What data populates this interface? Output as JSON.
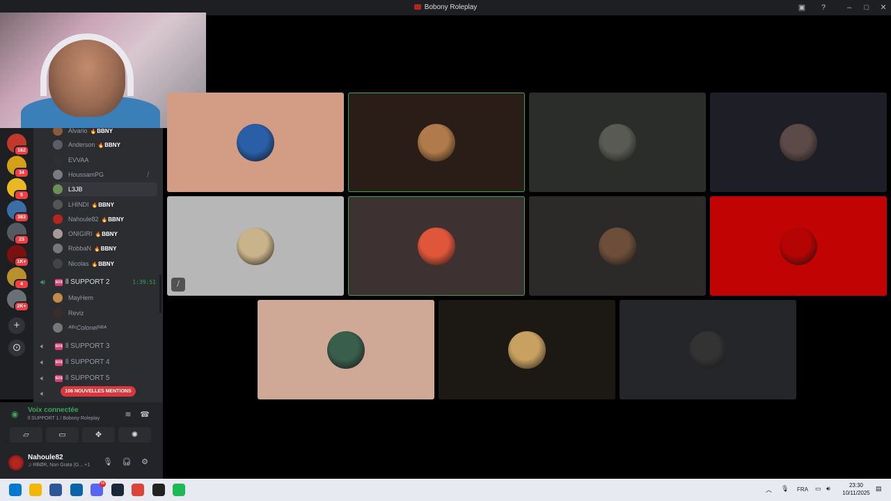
{
  "window": {
    "title": "Bobony Roleplay"
  },
  "icons": {
    "logo": "bobony-logo-icon",
    "inbox": "inbox-icon",
    "help": "help-icon",
    "minimize": "minimize-icon",
    "maximize": "maximize-icon",
    "close": "close-icon"
  },
  "servers": [
    {
      "name": "server-1",
      "badge": "162",
      "color": "#c0392b"
    },
    {
      "name": "server-2",
      "badge": "34",
      "color": "#d4a017"
    },
    {
      "name": "server-3",
      "badge": "5",
      "color": "#e8b923"
    },
    {
      "name": "server-4",
      "badge": "383",
      "color": "#3b6ea5"
    },
    {
      "name": "server-5",
      "badge": "23",
      "color": "#555a60"
    },
    {
      "name": "server-6",
      "badge": "1K+",
      "color": "#7a1111"
    },
    {
      "name": "server-7",
      "badge": "4",
      "color": "#b8912c"
    },
    {
      "name": "server-8",
      "badge": "2K+",
      "color": "#6b6f76"
    }
  ],
  "server_actions": {
    "add": "+",
    "discover": "⊙"
  },
  "members_top": [
    {
      "name": "Alvario",
      "tag": "BBNY",
      "color": "#8a5a3a"
    },
    {
      "name": "Anderson",
      "tag": "BBNY",
      "color": "#5a5f66"
    },
    {
      "name": "EVVAA",
      "tag": "",
      "color": "#2d2f33"
    },
    {
      "name": "HoussamPG",
      "tag": "",
      "color": "#777b82"
    },
    {
      "name": "L3JB",
      "tag": "",
      "color": "#6a8f58"
    },
    {
      "name": "LHINDI",
      "tag": "BBNY",
      "color": "#555"
    },
    {
      "name": "Nahoule82",
      "tag": "BBNY",
      "color": "#b3261e"
    },
    {
      "name": "ONIGIRI",
      "tag": "BBNY",
      "color": "#a99"
    },
    {
      "name": "RobbaN",
      "tag": "BBNY",
      "color": "#777"
    },
    {
      "name": "Nicolas",
      "tag": "BBNY",
      "color": "#444"
    }
  ],
  "support2": {
    "label": "SUPPORT 2",
    "timer": "1:39:51",
    "sos": "SOS",
    "prefix": "ll"
  },
  "members_support2": [
    {
      "name": "MayHem",
      "color": "#c48a4a"
    },
    {
      "name": "Reviz",
      "color": "#3a2d2a"
    },
    {
      "name": "ᴬᴮᶜColonelᴺᴮᴬ",
      "color": "#777"
    }
  ],
  "channels_other": [
    {
      "label": "SUPPORT 3"
    },
    {
      "label": "SUPPORT 4"
    },
    {
      "label": "SUPPORT 5"
    }
  ],
  "mentions_pill": "106 NOUVELLES MENTIONS",
  "voice": {
    "status": "Voix connectée",
    "channel": "ll SUPPORT 1 / Bobony Roleplay",
    "buttons": [
      "camera-off-icon",
      "screen-share-icon",
      "activities-icon",
      "soundboard-icon"
    ]
  },
  "user": {
    "name": "Nahoule82",
    "status": "♫ RBØR, Non Grata (G... +1"
  },
  "tiles": [
    {
      "bg": "#d39c84",
      "avatar": "#2a5fa8",
      "speaking": false,
      "muted": false
    },
    {
      "bg": "#2a1d18",
      "avatar": "#b07a4a",
      "speaking": true,
      "muted": false
    },
    {
      "bg": "#2a2d29",
      "avatar": "#5a5a55",
      "speaking": false,
      "muted": false
    },
    {
      "bg": "#1e1f26",
      "avatar": "#5c4a48",
      "speaking": false,
      "muted": false
    },
    {
      "bg": "#b7b7b7",
      "avatar": "#c9b38a",
      "speaking": false,
      "muted": true
    },
    {
      "bg": "#3d3131",
      "avatar": "#e0563a",
      "speaking": true,
      "muted": false
    },
    {
      "bg": "#2b2a28",
      "avatar": "#6d4e3a",
      "speaking": false,
      "muted": false
    },
    {
      "bg": "#c20303",
      "avatar": "#b50404",
      "speaking": false,
      "muted": false
    },
    {
      "bg": "#cfa896",
      "avatar": "#3a5e4c",
      "speaking": false,
      "muted": false
    },
    {
      "bg": "#1c1915",
      "avatar": "#c8a060",
      "speaking": false,
      "muted": false
    },
    {
      "bg": "#252629",
      "avatar": "#333",
      "speaking": false,
      "muted": false
    }
  ],
  "taskbar": {
    "apps": [
      {
        "name": "windows-start-icon",
        "color": "#0078d4"
      },
      {
        "name": "file-explorer-icon",
        "color": "#f2b705"
      },
      {
        "name": "calculator-icon",
        "color": "#2b579a"
      },
      {
        "name": "outlook-icon",
        "color": "#0a64ad"
      },
      {
        "name": "discord-icon",
        "color": "#5865f2"
      },
      {
        "name": "steam-icon",
        "color": "#1b2838"
      },
      {
        "name": "chrome-icon",
        "color": "#db4437"
      },
      {
        "name": "app-icon",
        "color": "#222"
      },
      {
        "name": "spotify-icon",
        "color": "#1db954"
      }
    ],
    "discord_badge": "99",
    "language": "FRA",
    "time": "23:30",
    "date": "10/11/2025"
  }
}
